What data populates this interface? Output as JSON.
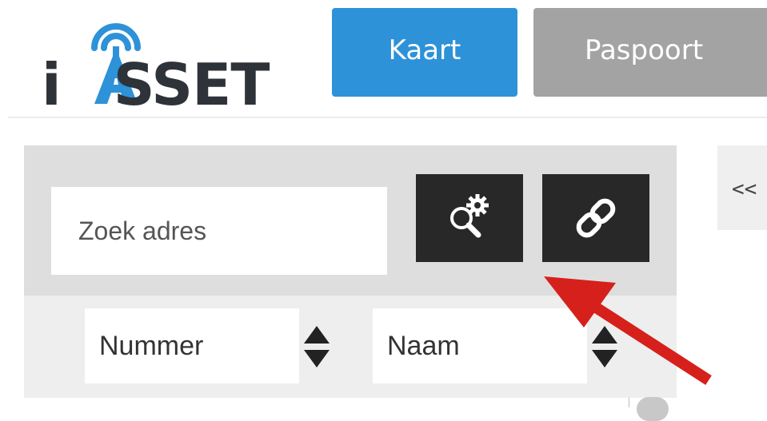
{
  "logo": {
    "text_left": "i",
    "text_right": "SSET"
  },
  "nav": {
    "kaart_label": "Kaart",
    "paspoort_label": "Paspoort"
  },
  "search": {
    "placeholder": "Zoek adres"
  },
  "toolbar": {
    "search_settings_icon": "search-settings-icon",
    "link_icon": "link-icon"
  },
  "sort": {
    "number_label": "Nummer",
    "name_label": "Naam"
  },
  "side_panel": {
    "collapse_label": "<<"
  },
  "colors": {
    "primary": "#2e92d8",
    "inactive": "#a3a3a3",
    "dark_button": "#282828",
    "annotation_arrow": "#d6201b"
  }
}
